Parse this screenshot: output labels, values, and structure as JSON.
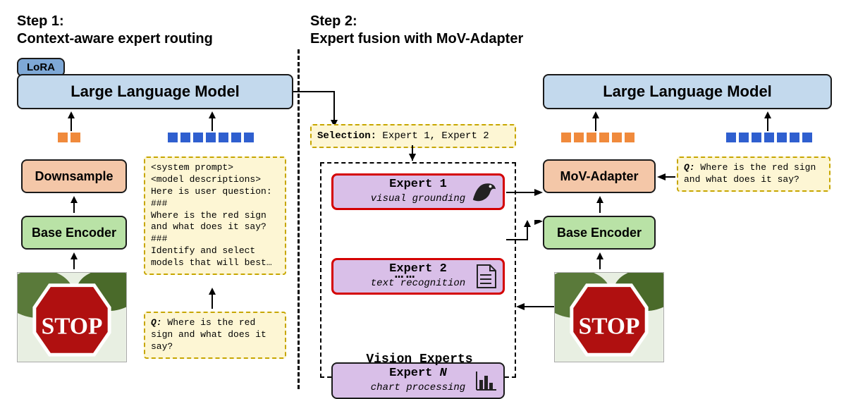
{
  "step1": {
    "title": "Step 1:\nContext-aware expert routing",
    "llm": "Large Language Model",
    "lora": "LoRA",
    "downsample": "Downsample",
    "encoder": "Base Encoder",
    "question_label": "Q:",
    "question": "Where is the red sign and what does it say?",
    "prompt_lines": [
      "<system prompt>",
      "<model descriptions>",
      "Here is user question:",
      "###",
      "Where is the red sign and what does it say?",
      "###",
      "Identify and select models that will best…"
    ]
  },
  "step2": {
    "title": "Step 2:\nExpert fusion with MoV-Adapter",
    "llm": "Large Language Model",
    "selection_label": "Selection:",
    "selection_value": "Expert 1, Expert 2",
    "experts_label": "Vision Experts",
    "experts": [
      {
        "name": "Expert 1",
        "role": "visual grounding",
        "icon": "eagle",
        "selected": true
      },
      {
        "name": "Expert 2",
        "role": "text recognition",
        "icon": "document",
        "selected": true
      },
      {
        "name_template": "Expert N",
        "role": "chart processing",
        "icon": "chart",
        "selected": false
      }
    ],
    "ellipsis": "……",
    "mov": "MoV-Adapter",
    "encoder": "Base Encoder",
    "question_label": "Q:",
    "question": "Where is the red sign and what does it say?"
  }
}
